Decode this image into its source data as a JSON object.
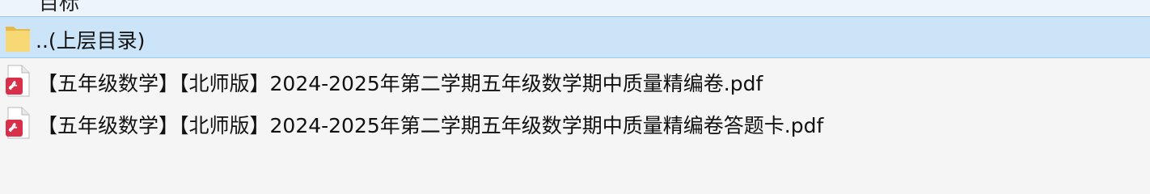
{
  "file_list": {
    "partial_top_row_label": "目标",
    "rows": [
      {
        "label": "..(上层目录)",
        "icon": "folder-icon",
        "selected": true
      },
      {
        "label": "【五年级数学】【北师版】2024-2025年第二学期五年级数学期中质量精编卷.pdf",
        "icon": "pdf-file-icon",
        "selected": false
      },
      {
        "label": "【五年级数学】【北师版】2024-2025年第二学期五年级数学期中质量精编卷答题卡.pdf",
        "icon": "pdf-file-icon",
        "selected": false
      }
    ]
  },
  "colors": {
    "selected_row_bg": "#cce4f7",
    "selected_row_border": "#99c9ef",
    "folder": "#f8d775",
    "pdf_badge": "#d8304a"
  }
}
